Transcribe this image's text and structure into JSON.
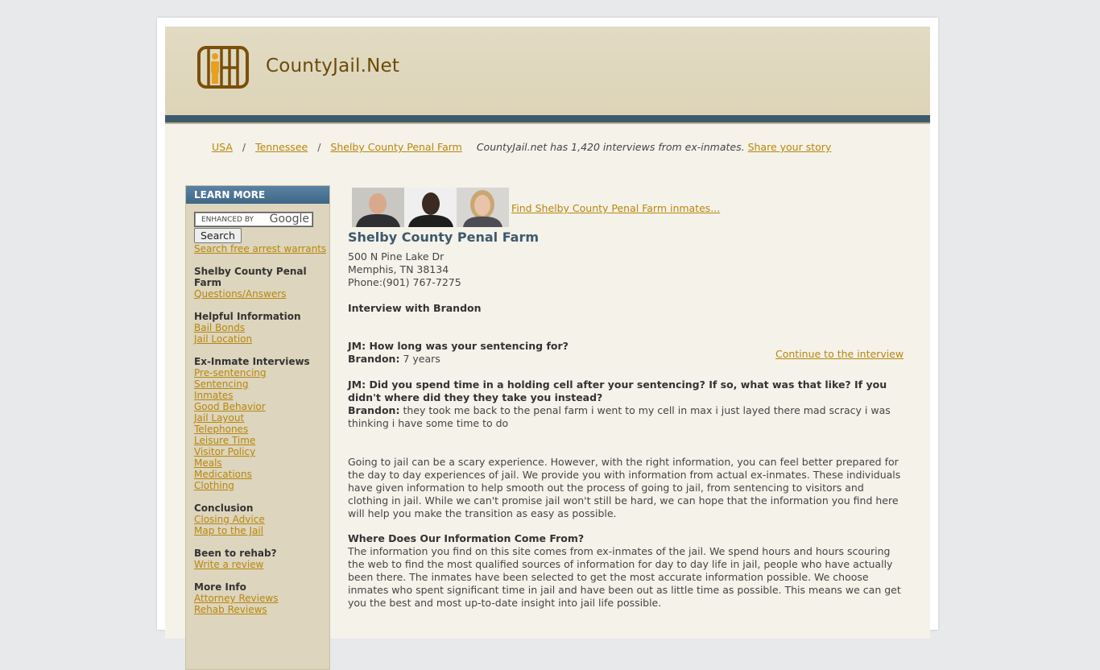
{
  "site": {
    "name": "CountyJail.Net"
  },
  "breadcrumb": {
    "items": [
      "USA",
      "Tennessee",
      "Shelby County Penal Farm"
    ],
    "separator": "/",
    "note": "CountyJail.net has 1,420 interviews from ex-inmates.",
    "share_link": "Share your story"
  },
  "sidebar": {
    "header": "LEARN MORE",
    "search_placeholder": "ENHANCED BY",
    "search_brand": "Google",
    "search_button": "Search",
    "warrants_link": "Search free arrest warrants",
    "sections": [
      {
        "title": "Shelby County Penal Farm",
        "links": [
          "Questions/Answers"
        ]
      },
      {
        "title": "Helpful Information",
        "links": [
          "Bail Bonds",
          "Jail Location"
        ]
      },
      {
        "title": "Ex-Inmate Interviews",
        "links": [
          "Pre-sentencing",
          "Sentencing",
          "Inmates",
          "Good Behavior",
          "Jail Layout",
          "Telephones",
          "Leisure Time",
          "Visitor Policy",
          "Meals",
          "Medications",
          "Clothing"
        ]
      },
      {
        "title": "Conclusion",
        "links": [
          "Closing Advice",
          "Map to the Jail"
        ]
      },
      {
        "title": "Been to rehab?",
        "links": [
          "Write a review"
        ]
      },
      {
        "title": "More Info",
        "links": [
          "Attorney Reviews",
          "Rehab Reviews"
        ]
      }
    ]
  },
  "main": {
    "find_inmates_link": "Find Shelby County Penal Farm inmates...",
    "facility_name": "Shelby County Penal Farm",
    "address_line1": "500 N Pine Lake Dr",
    "address_line2": "Memphis, TN 38134",
    "phone": "Phone:(901) 767-7275",
    "interview_title": "Interview with Brandon",
    "q1": "JM: How long was your sentencing for?",
    "a1_speaker": "Brandon:",
    "a1": " 7 years",
    "q2": "JM: Did you spend time in a holding cell after your sentencing? If so, what was that like? If you didn't where did they they take you instead?",
    "a2_speaker": "Brandon:",
    "a2": " they took me back to the penal farm i went to my cell in max i just layed there mad scracy i was thinking i have some time to do",
    "continue_link": "Continue to the interview",
    "intro_paragraph": "Going to jail can be a scary experience. However, with the right information, you can feel better prepared for the day to day experiences of jail. We provide you with information from actual ex-inmates. These individuals have given information to help smooth out the process of going to jail, from sentencing to visitors and clothing in jail. While we can't promise jail won't still be hard, we can hope that the information you find here will help you make the transition as easy as possible.",
    "info_title": "Where Does Our Information Come From?",
    "info_paragraph": "The information you find on this site comes from ex-inmates of the jail. We spend hours and hours scouring the web to find the most qualified sources of information for day to day life in jail, people who have actually been there. The inmates have been selected to get the most accurate information possible. We choose inmates who spent significant time in jail and have been out as little time as possible. This means we can get you the best and most up-to-date insight into jail life possible."
  }
}
